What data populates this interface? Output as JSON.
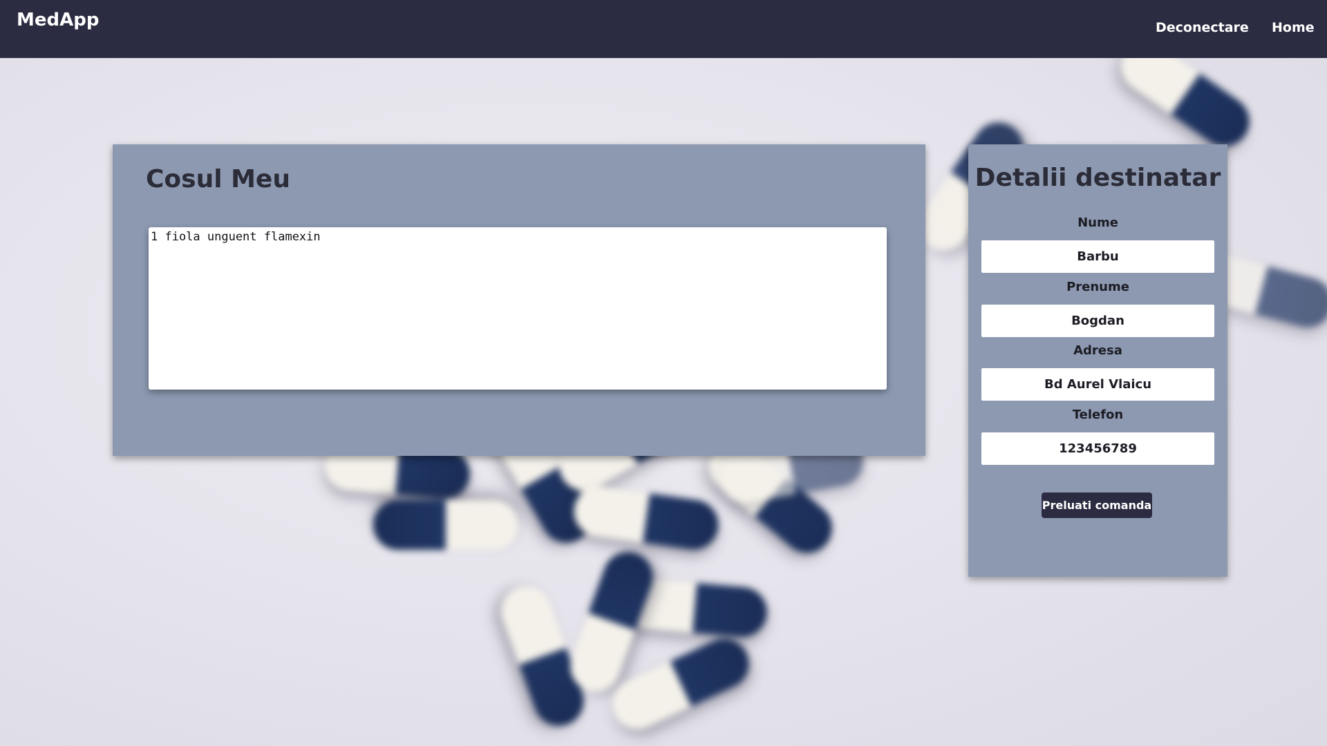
{
  "header": {
    "brand": "MedApp",
    "nav": {
      "logout_label": "Deconectare",
      "home_label": "Home"
    }
  },
  "cart": {
    "title": "Cosul Meu",
    "contents": "1 fiola unguent flamexin"
  },
  "recipient": {
    "title": "Detalii destinatar",
    "fields": {
      "last_name": {
        "label": "Nume",
        "value": "Barbu"
      },
      "first_name": {
        "label": "Prenume",
        "value": "Bogdan"
      },
      "address": {
        "label": "Adresa",
        "value": "Bd Aurel Vlaicu"
      },
      "phone": {
        "label": "Telefon",
        "value": "123456789"
      }
    },
    "submit_label": "Preluati comanda"
  },
  "colors": {
    "header_bg": "#2b2c41",
    "panel_bg": "#8d99b1",
    "capsule_blue": "#1f3563",
    "capsule_white": "#f4f1ea"
  }
}
